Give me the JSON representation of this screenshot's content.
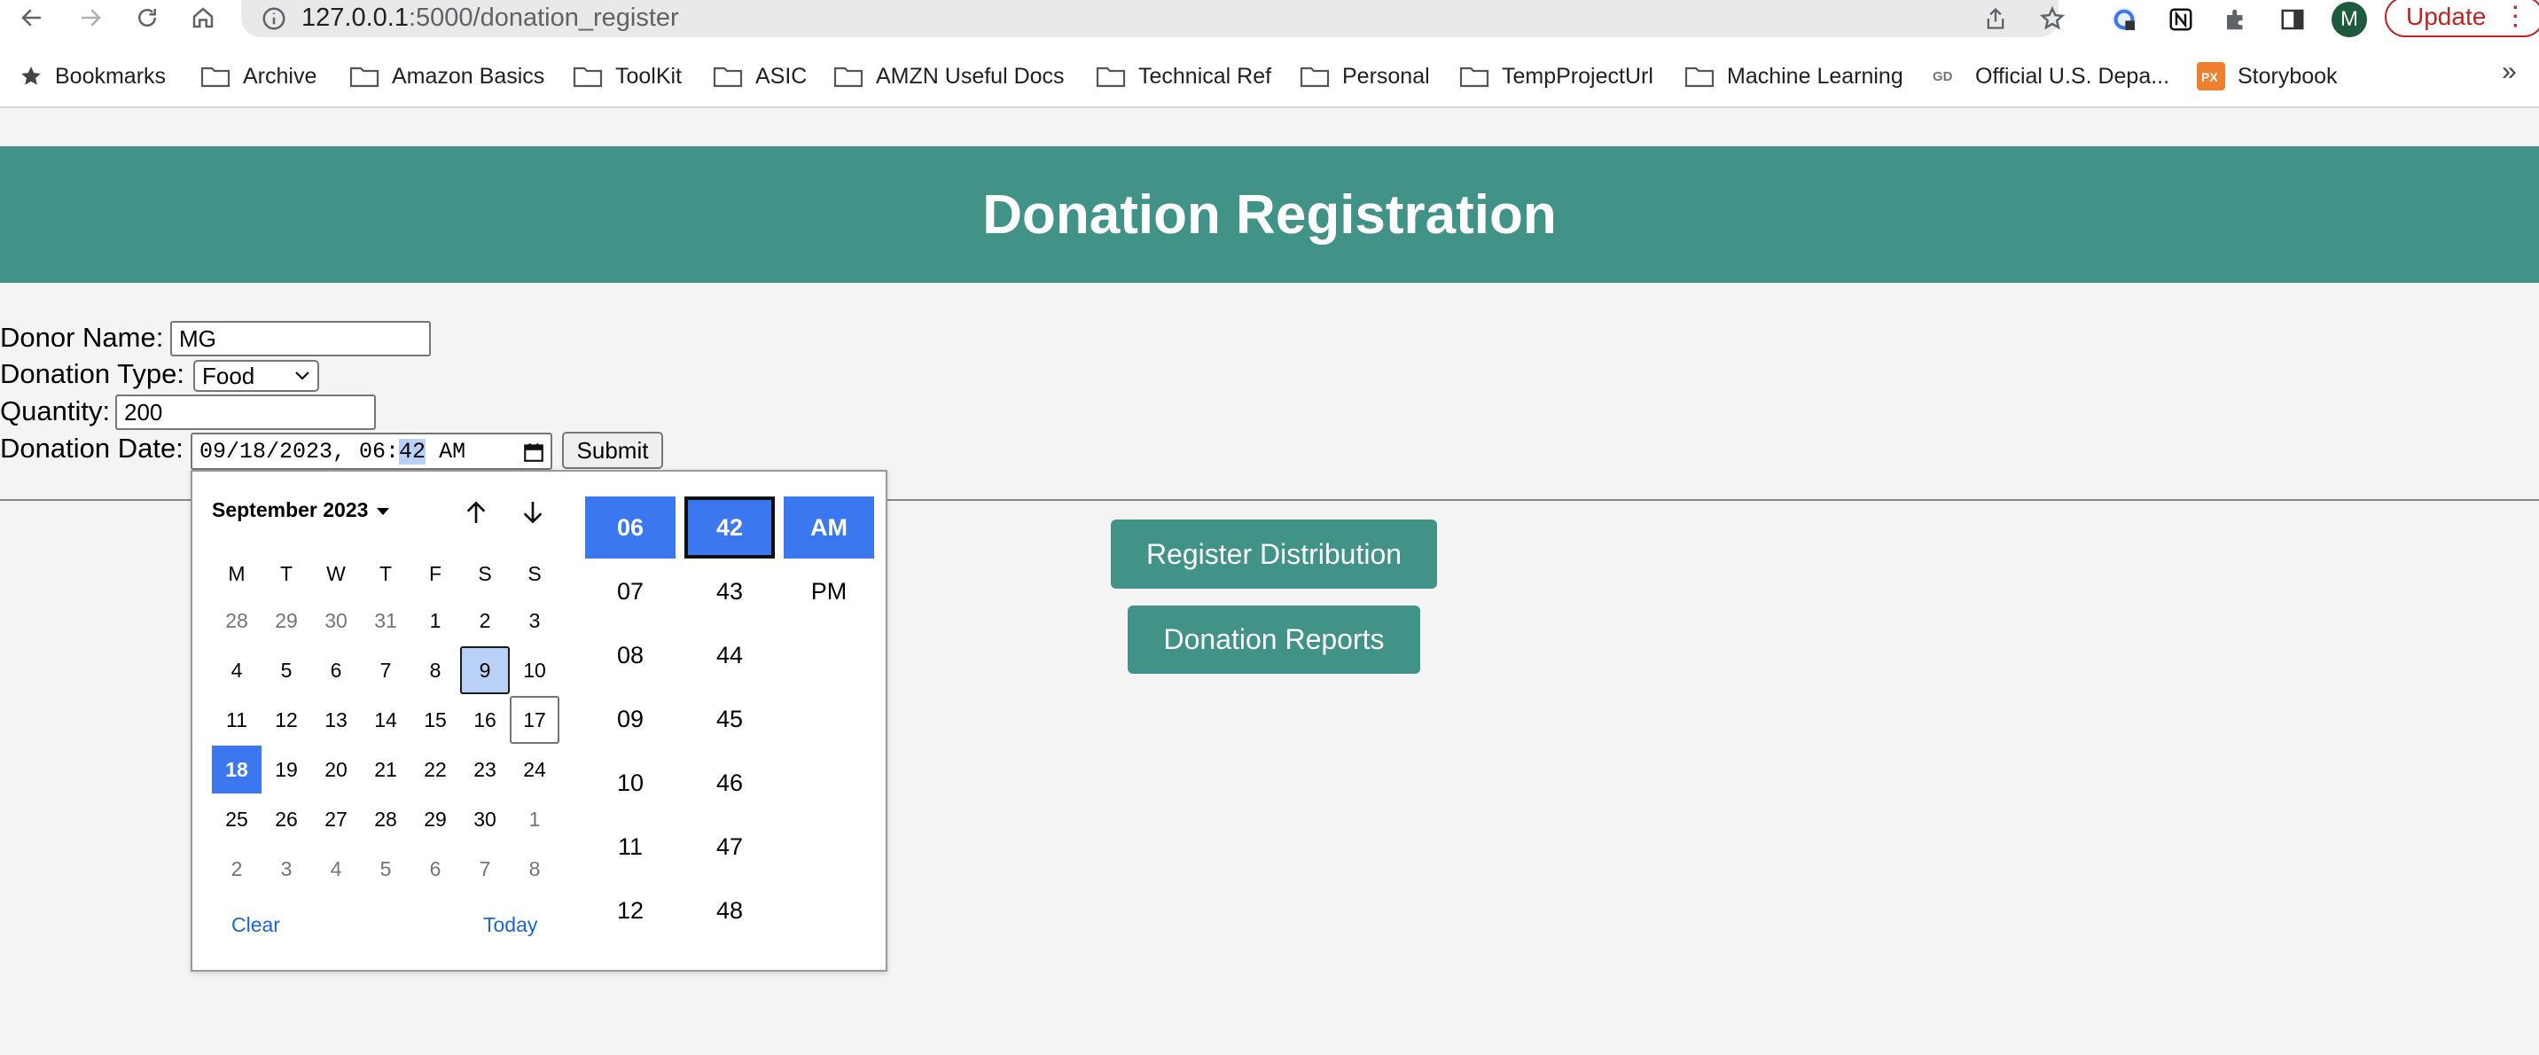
{
  "browser": {
    "url_host": "127.0.0.1",
    "url_path": ":5000/donation_register",
    "avatar_letter": "M",
    "update_label": "Update",
    "bookmarks": [
      "Bookmarks",
      "Archive",
      "Amazon Basics",
      "ToolKit",
      "ASIC",
      "AMZN Useful Docs",
      "Technical Ref",
      "Personal",
      "TempProjectUrl",
      "Machine Learning",
      "Official U.S. Depa...",
      "Storybook"
    ],
    "more": "»"
  },
  "page": {
    "title": "Donation Registration",
    "form": {
      "donor_name_label": "Donor Name:",
      "donor_name_value": "MG",
      "donation_type_label": "Donation Type:",
      "donation_type_value": "Food",
      "quantity_label": "Quantity:",
      "quantity_value": "200",
      "donation_date_label": "Donation Date:",
      "date_value_prefix": "09/18/2023, 06:",
      "date_value_minute": "42",
      "date_value_suffix": " AM",
      "submit_label": "Submit"
    },
    "register_distribution_label": "Register Distribution",
    "donation_reports_label": "Donation Reports"
  },
  "picker": {
    "month_label": "September 2023",
    "weekdays": [
      "M",
      "T",
      "W",
      "T",
      "F",
      "S",
      "S"
    ],
    "weeks": [
      [
        "28",
        "29",
        "30",
        "31",
        "1",
        "2",
        "3"
      ],
      [
        "4",
        "5",
        "6",
        "7",
        "8",
        "9",
        "10"
      ],
      [
        "11",
        "12",
        "13",
        "14",
        "15",
        "16",
        "17"
      ],
      [
        "18",
        "19",
        "20",
        "21",
        "22",
        "23",
        "24"
      ],
      [
        "25",
        "26",
        "27",
        "28",
        "29",
        "30",
        "1"
      ],
      [
        "2",
        "3",
        "4",
        "5",
        "6",
        "7",
        "8"
      ]
    ],
    "clear_label": "Clear",
    "today_label": "Today",
    "hours": [
      "06",
      "07",
      "08",
      "09",
      "10",
      "11",
      "12"
    ],
    "minutes": [
      "42",
      "43",
      "44",
      "45",
      "46",
      "47",
      "48"
    ],
    "periods": [
      "AM",
      "PM"
    ]
  },
  "colors": {
    "header_teal": "#419387",
    "selected_blue": "#3b78ef",
    "focus_light_blue": "#b9d1f7",
    "link_blue": "#1a67d2",
    "update_red": "#c5221f"
  }
}
